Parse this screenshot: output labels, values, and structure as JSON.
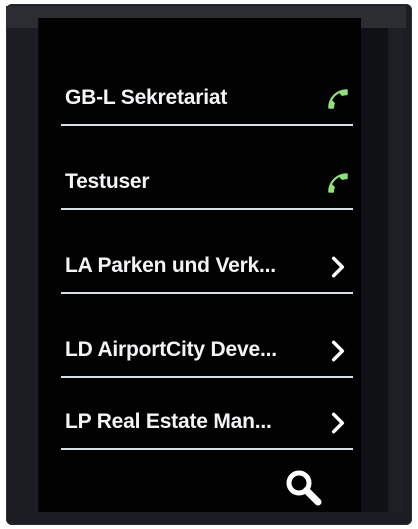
{
  "contacts": [
    {
      "label": "GB-L Sekretariat",
      "trailing_icon": "phone-icon"
    },
    {
      "label": "Testuser",
      "trailing_icon": "phone-icon"
    },
    {
      "label": "LA Parken und Verk...",
      "trailing_icon": "chevron-right-icon"
    },
    {
      "label": "LD AirportCity Deve...",
      "trailing_icon": "chevron-right-icon"
    },
    {
      "label": "LP Real Estate Man...",
      "trailing_icon": "chevron-right-icon"
    }
  ],
  "footer": {
    "icon": "search-icon"
  },
  "colors": {
    "text": "#f2f4f6",
    "phone_icon": "#8fe07a",
    "divider": "#d8dfe6",
    "background": "#020203"
  }
}
